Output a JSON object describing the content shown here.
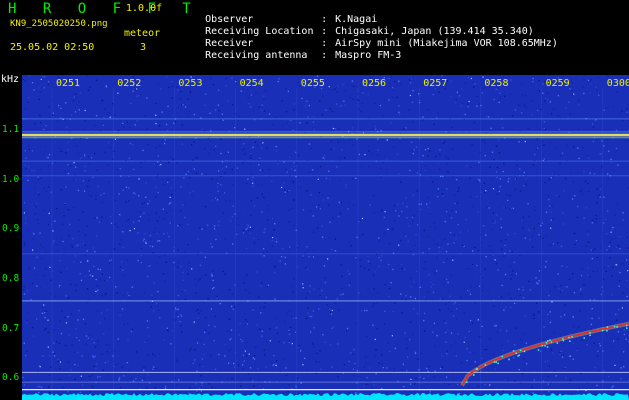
{
  "header": {
    "app_title": "H R O F F T",
    "version": "1.0.0f",
    "filename": "KN9_2505020250.png",
    "mode_label": "meteor",
    "timestamp": "25.05.02 02:50",
    "mode_value": "3",
    "info": [
      {
        "label": "Observer",
        "value": "K.Nagai"
      },
      {
        "label": "Receiving Location",
        "value": "Chigasaki, Japan (139.414 35.340)"
      },
      {
        "label": "Receiver",
        "value": "AirSpy mini (Miakejima VOR 108.65MHz)"
      },
      {
        "label": "Receiving antenna",
        "value": "Maspro FM-3"
      }
    ]
  },
  "axis": {
    "unit": "kHz",
    "y_ticks": [
      "1.1",
      "1.0",
      "0.9",
      "0.8",
      "0.7",
      "0.6"
    ],
    "time_labels": [
      "0251",
      "0252",
      "0253",
      "0254",
      "0255",
      "0256",
      "0257",
      "0258",
      "0259",
      "0300"
    ]
  },
  "colors": {
    "background": "#000000",
    "noise": "#1a2fb8",
    "label_green": "#00ee00",
    "label_yellow": "#f5f000",
    "signal_line": "#e8e8a0",
    "meteor_trail": "#e03020",
    "baseline": "#00e5ff"
  }
}
